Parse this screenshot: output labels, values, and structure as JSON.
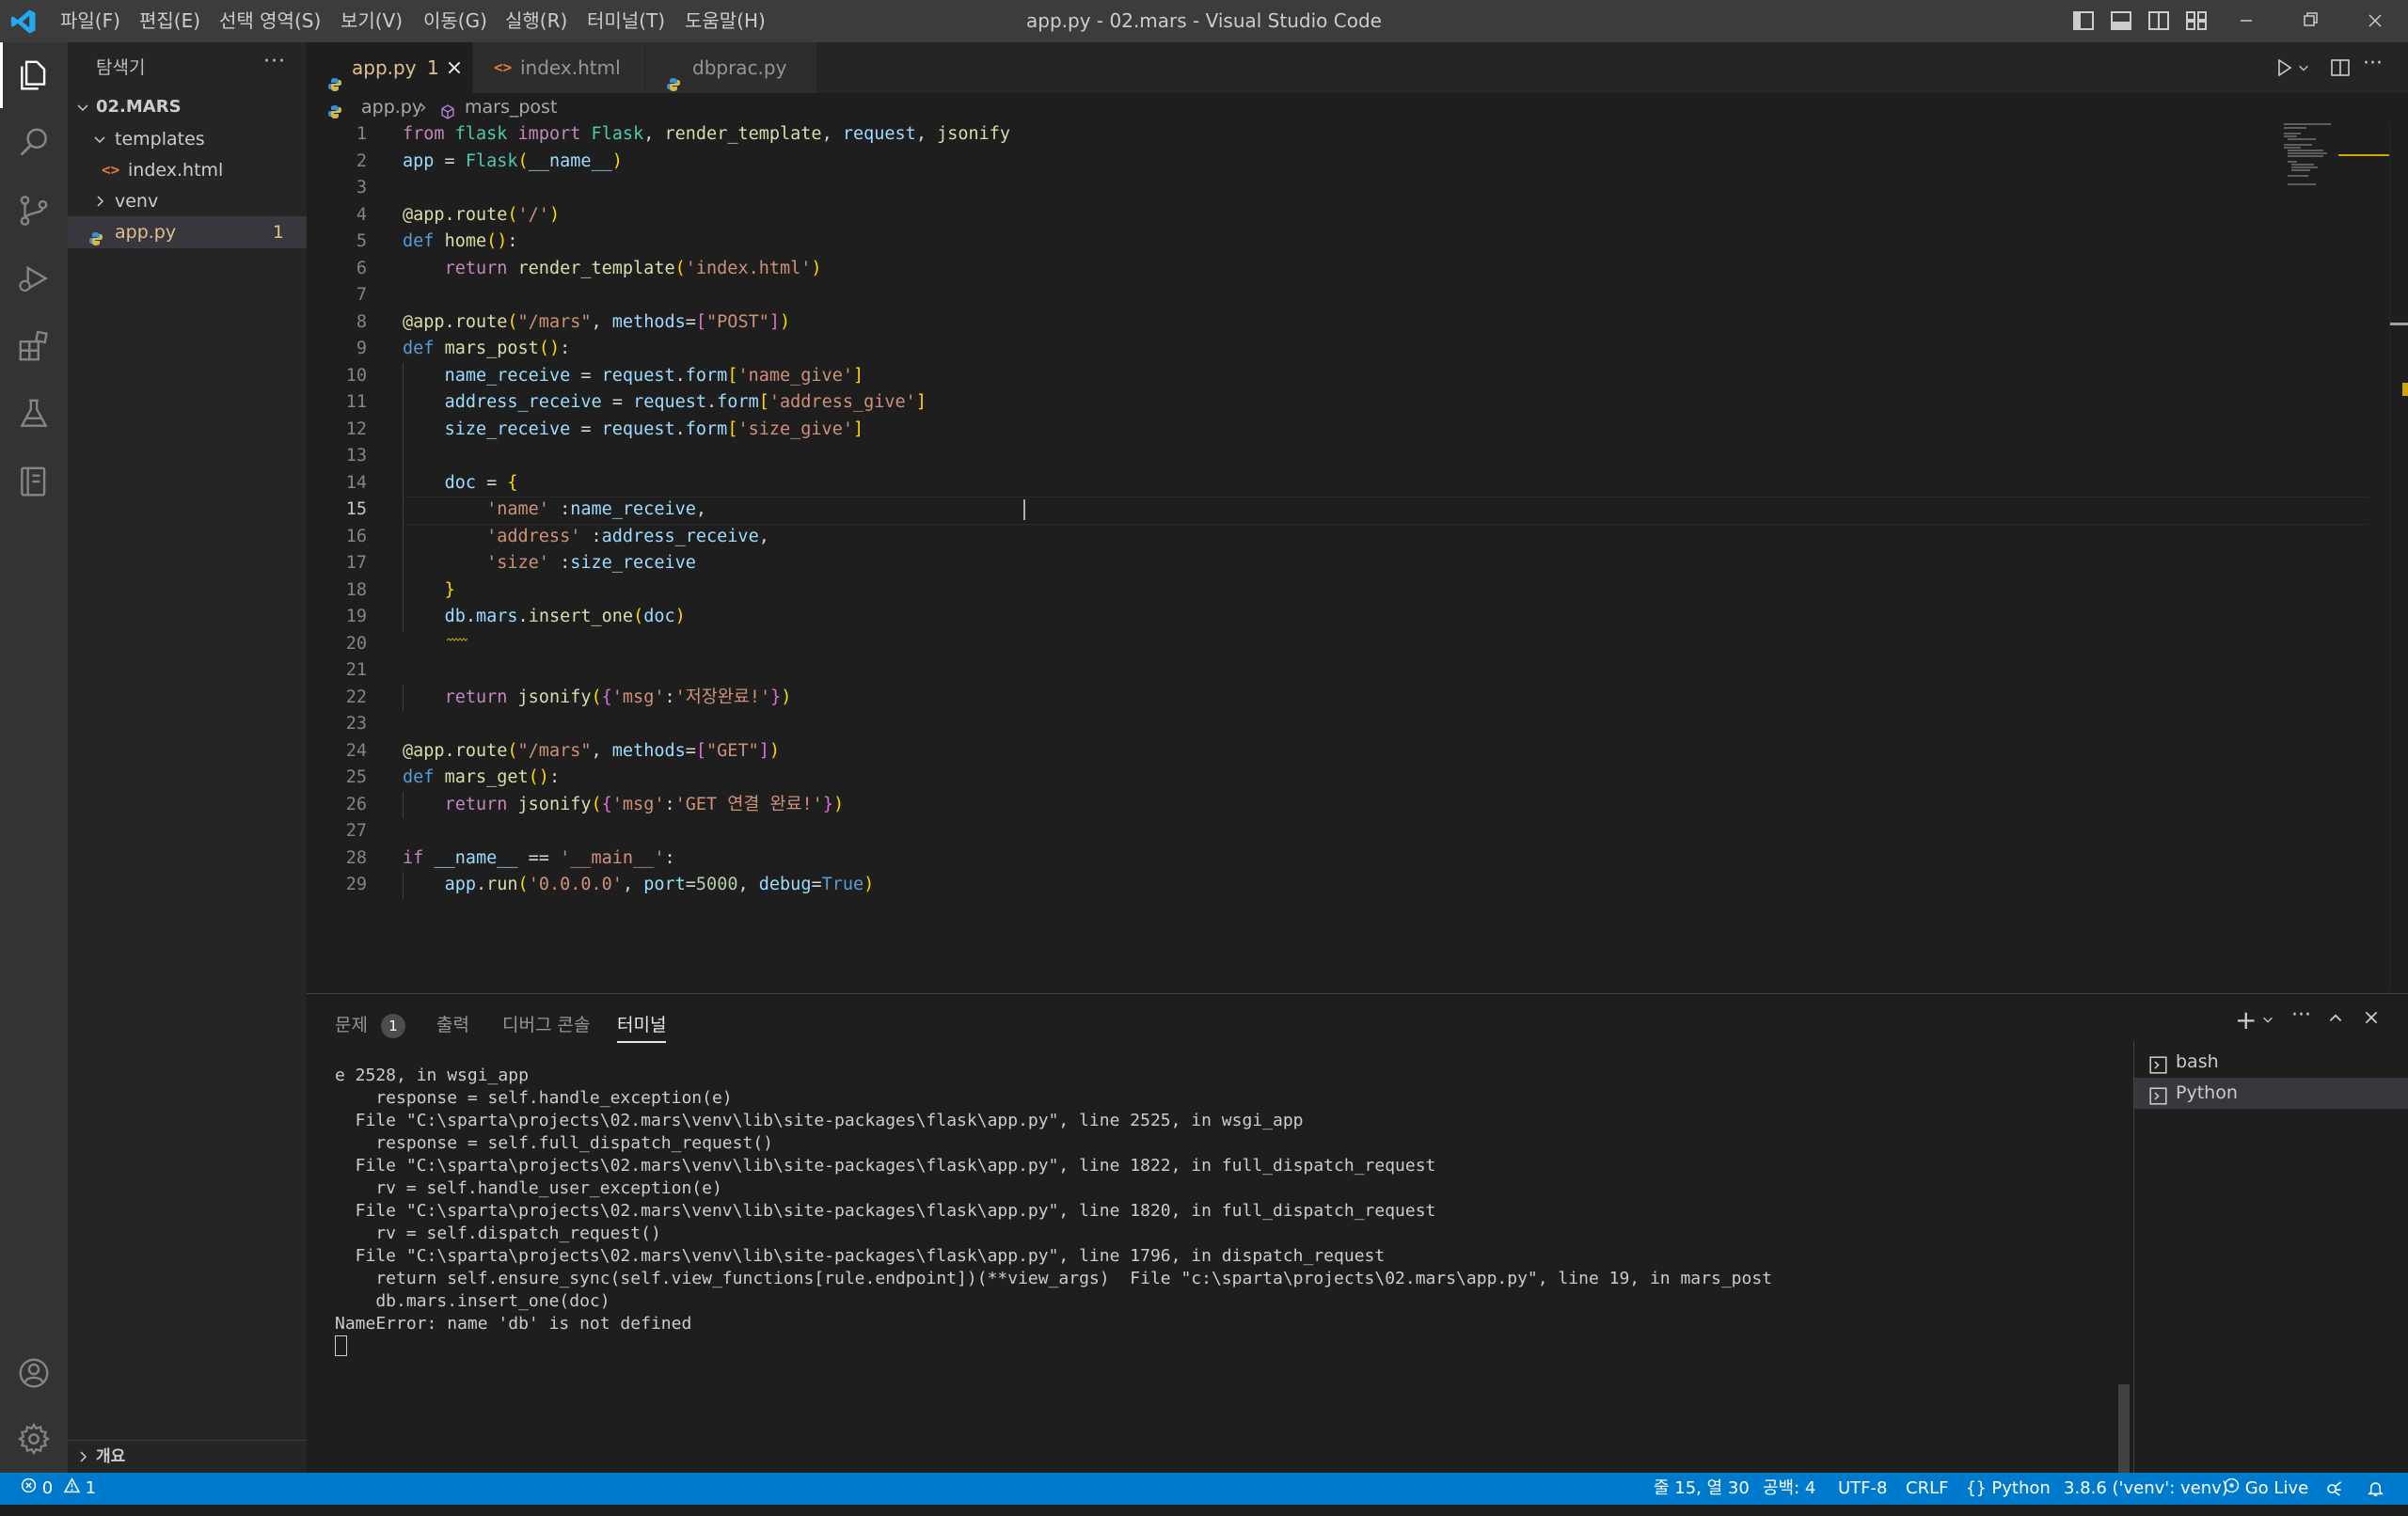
{
  "window": {
    "title": "app.py - 02.mars - Visual Studio Code",
    "menu": [
      "파일(F)",
      "편집(E)",
      "선택 영역(S)",
      "보기(V)",
      "이동(G)",
      "실행(R)",
      "터미널(T)",
      "도움말(H)"
    ]
  },
  "sidebar": {
    "header": "탐색기",
    "root": "02.MARS",
    "tree": [
      {
        "label": "templates",
        "type": "folder-open"
      },
      {
        "label": "index.html",
        "type": "html-file"
      },
      {
        "label": "venv",
        "type": "folder"
      },
      {
        "label": "app.py",
        "type": "python-file",
        "badge": "1"
      }
    ],
    "outline_label": "개요"
  },
  "tabs": [
    {
      "label": "app.py",
      "badge": "1",
      "active": true
    },
    {
      "label": "index.html",
      "active": false
    },
    {
      "label": "dbprac.py",
      "active": false
    }
  ],
  "breadcrumb": {
    "file": "app.py",
    "symbol": "mars_post"
  },
  "code": {
    "line_numbers": [
      "1",
      "2",
      "3",
      "4",
      "5",
      "6",
      "7",
      "8",
      "9",
      "10",
      "11",
      "12",
      "13",
      "14",
      "15",
      "16",
      "17",
      "18",
      "19",
      "20",
      "21",
      "22",
      "23",
      "24",
      "25",
      "26",
      "27",
      "28",
      "29"
    ],
    "current_line": "15",
    "lines": [
      [
        [
          "kw",
          "from"
        ],
        [
          "",
          " "
        ],
        [
          "cls",
          "flask"
        ],
        [
          "",
          " "
        ],
        [
          "kw",
          "import"
        ],
        [
          "",
          " "
        ],
        [
          "cls",
          "Flask"
        ],
        [
          "",
          ", "
        ],
        [
          "fn",
          "render_template"
        ],
        [
          "",
          ", "
        ],
        [
          "var",
          "request"
        ],
        [
          "",
          ", "
        ],
        [
          "fn",
          "jsonify"
        ]
      ],
      [
        [
          "var",
          "app"
        ],
        [
          "",
          " = "
        ],
        [
          "cls",
          "Flask"
        ],
        [
          "br1",
          "("
        ],
        [
          "var",
          "__name__"
        ],
        [
          "br1",
          ")"
        ]
      ],
      [],
      [
        [
          "fn",
          "@app.route"
        ],
        [
          "br1",
          "("
        ],
        [
          "st-s",
          "'/'"
        ],
        [
          "br1",
          ")"
        ]
      ],
      [
        [
          "kb",
          "def"
        ],
        [
          "",
          " "
        ],
        [
          "fn",
          "home"
        ],
        [
          "br1",
          "()"
        ],
        [
          "",
          ":"
        ]
      ],
      [
        [
          "",
          "    "
        ],
        [
          "kw",
          "return"
        ],
        [
          "",
          " "
        ],
        [
          "fn",
          "render_template"
        ],
        [
          "br1",
          "("
        ],
        [
          "st-s",
          "'index.html'"
        ],
        [
          "br1",
          ")"
        ]
      ],
      [],
      [
        [
          "fn",
          "@app.route"
        ],
        [
          "br1",
          "("
        ],
        [
          "st-s",
          "\"/mars\""
        ],
        [
          "",
          ", "
        ],
        [
          "var",
          "methods"
        ],
        [
          "",
          "="
        ],
        [
          "br2",
          "["
        ],
        [
          "st-s",
          "\"POST\""
        ],
        [
          "br2",
          "]"
        ],
        [
          "br1",
          ")"
        ]
      ],
      [
        [
          "kb",
          "def"
        ],
        [
          "",
          " "
        ],
        [
          "fn",
          "mars_post"
        ],
        [
          "br1",
          "()"
        ],
        [
          "",
          ":"
        ]
      ],
      [
        [
          "",
          "    "
        ],
        [
          "var",
          "name_receive"
        ],
        [
          "",
          " = "
        ],
        [
          "var",
          "request"
        ],
        [
          "",
          "."
        ],
        [
          "var",
          "form"
        ],
        [
          "br1",
          "["
        ],
        [
          "st-s",
          "'name_give'"
        ],
        [
          "br1",
          "]"
        ]
      ],
      [
        [
          "",
          "    "
        ],
        [
          "var",
          "address_receive"
        ],
        [
          "",
          " = "
        ],
        [
          "var",
          "request"
        ],
        [
          "",
          "."
        ],
        [
          "var",
          "form"
        ],
        [
          "br1",
          "["
        ],
        [
          "st-s",
          "'address_give'"
        ],
        [
          "br1",
          "]"
        ]
      ],
      [
        [
          "",
          "    "
        ],
        [
          "var",
          "size_receive"
        ],
        [
          "",
          " = "
        ],
        [
          "var",
          "request"
        ],
        [
          "",
          "."
        ],
        [
          "var",
          "form"
        ],
        [
          "br1",
          "["
        ],
        [
          "st-s",
          "'size_give'"
        ],
        [
          "br1",
          "]"
        ]
      ],
      [],
      [
        [
          "",
          "    "
        ],
        [
          "var",
          "doc"
        ],
        [
          "",
          " = "
        ],
        [
          "br1",
          "{"
        ]
      ],
      [
        [
          "",
          "        "
        ],
        [
          "st-s",
          "'name'"
        ],
        [
          "",
          " :"
        ],
        [
          "var",
          "name_receive"
        ],
        [
          "",
          ","
        ]
      ],
      [
        [
          "",
          "        "
        ],
        [
          "st-s",
          "'address'"
        ],
        [
          "",
          " :"
        ],
        [
          "var",
          "address_receive"
        ],
        [
          "",
          ","
        ]
      ],
      [
        [
          "",
          "        "
        ],
        [
          "st-s",
          "'size'"
        ],
        [
          "",
          " :"
        ],
        [
          "var",
          "size_receive"
        ]
      ],
      [
        [
          "",
          "    "
        ],
        [
          "br1",
          "}"
        ]
      ],
      [
        [
          "",
          "    "
        ],
        [
          "var",
          "db"
        ],
        [
          "",
          "."
        ],
        [
          "var",
          "mars"
        ],
        [
          "",
          "."
        ],
        [
          "fn",
          "insert_one"
        ],
        [
          "br1",
          "("
        ],
        [
          "var",
          "doc"
        ],
        [
          "br1",
          ")"
        ]
      ],
      [],
      [],
      [
        [
          "",
          "    "
        ],
        [
          "kw",
          "return"
        ],
        [
          "",
          " "
        ],
        [
          "fn",
          "jsonify"
        ],
        [
          "br1",
          "("
        ],
        [
          "br2",
          "{"
        ],
        [
          "st-s",
          "'msg'"
        ],
        [
          "",
          ":"
        ],
        [
          "st-s",
          "'저장완료!'"
        ],
        [
          "br2",
          "}"
        ],
        [
          "br1",
          ")"
        ]
      ],
      [],
      [
        [
          "fn",
          "@app.route"
        ],
        [
          "br1",
          "("
        ],
        [
          "st-s",
          "\"/mars\""
        ],
        [
          "",
          ", "
        ],
        [
          "var",
          "methods"
        ],
        [
          "",
          "="
        ],
        [
          "br2",
          "["
        ],
        [
          "st-s",
          "\"GET\""
        ],
        [
          "br2",
          "]"
        ],
        [
          "br1",
          ")"
        ]
      ],
      [
        [
          "kb",
          "def"
        ],
        [
          "",
          " "
        ],
        [
          "fn",
          "mars_get"
        ],
        [
          "br1",
          "()"
        ],
        [
          "",
          ":"
        ]
      ],
      [
        [
          "",
          "    "
        ],
        [
          "kw",
          "return"
        ],
        [
          "",
          " "
        ],
        [
          "fn",
          "jsonify"
        ],
        [
          "br1",
          "("
        ],
        [
          "br2",
          "{"
        ],
        [
          "st-s",
          "'msg'"
        ],
        [
          "",
          ":"
        ],
        [
          "st-s",
          "'GET 연결 완료!'"
        ],
        [
          "br2",
          "}"
        ],
        [
          "br1",
          ")"
        ]
      ],
      [],
      [
        [
          "kw",
          "if"
        ],
        [
          "",
          " "
        ],
        [
          "var",
          "__name__"
        ],
        [
          "",
          " == "
        ],
        [
          "st-s",
          "'__main__'"
        ],
        [
          "",
          ":"
        ]
      ],
      [
        [
          "",
          "    "
        ],
        [
          "var",
          "app"
        ],
        [
          "",
          "."
        ],
        [
          "fn",
          "run"
        ],
        [
          "br1",
          "("
        ],
        [
          "st-s",
          "'0.0.0.0'"
        ],
        [
          "",
          ", "
        ],
        [
          "var",
          "port"
        ],
        [
          "",
          "="
        ],
        [
          "num",
          "5000"
        ],
        [
          "",
          ", "
        ],
        [
          "var",
          "debug"
        ],
        [
          "",
          "="
        ],
        [
          "kb",
          "True"
        ],
        [
          "br1",
          ")"
        ]
      ]
    ]
  },
  "panel": {
    "tabs": [
      {
        "label": "문제",
        "badge": "1"
      },
      {
        "label": "출력"
      },
      {
        "label": "디버그 콘솔"
      },
      {
        "label": "터미널",
        "active": true
      }
    ],
    "terminal_lines": [
      "e 2528, in wsgi_app",
      "    response = self.handle_exception(e)",
      "  File \"C:\\sparta\\projects\\02.mars\\venv\\lib\\site-packages\\flask\\app.py\", line 2525, in wsgi_app",
      "    response = self.full_dispatch_request()",
      "  File \"C:\\sparta\\projects\\02.mars\\venv\\lib\\site-packages\\flask\\app.py\", line 1822, in full_dispatch_request",
      "    rv = self.handle_user_exception(e)",
      "  File \"C:\\sparta\\projects\\02.mars\\venv\\lib\\site-packages\\flask\\app.py\", line 1820, in full_dispatch_request",
      "    rv = self.dispatch_request()",
      "  File \"C:\\sparta\\projects\\02.mars\\venv\\lib\\site-packages\\flask\\app.py\", line 1796, in dispatch_request",
      "    return self.ensure_sync(self.view_functions[rule.endpoint])(**view_args)  File \"c:\\sparta\\projects\\02.mars\\app.py\", line 19, in mars_post",
      "    db.mars.insert_one(doc)",
      "NameError: name 'db' is not defined"
    ],
    "terminals": [
      {
        "label": "bash",
        "active": false
      },
      {
        "label": "Python",
        "active": true
      }
    ]
  },
  "statusbar": {
    "errors": "0",
    "warnings": "1",
    "cursor": "줄 15, 열 30",
    "spaces": "공백: 4",
    "encoding": "UTF-8",
    "eol": "CRLF",
    "language": "Python",
    "interpreter": "3.8.6 ('venv': venv)",
    "golive": "Go Live"
  },
  "colors": {
    "accent": "#007acc",
    "warning": "#cca700",
    "titlebar": "#3c3c3c",
    "activitybar": "#333333",
    "sidebar": "#252526",
    "editor": "#1e1e1e"
  }
}
